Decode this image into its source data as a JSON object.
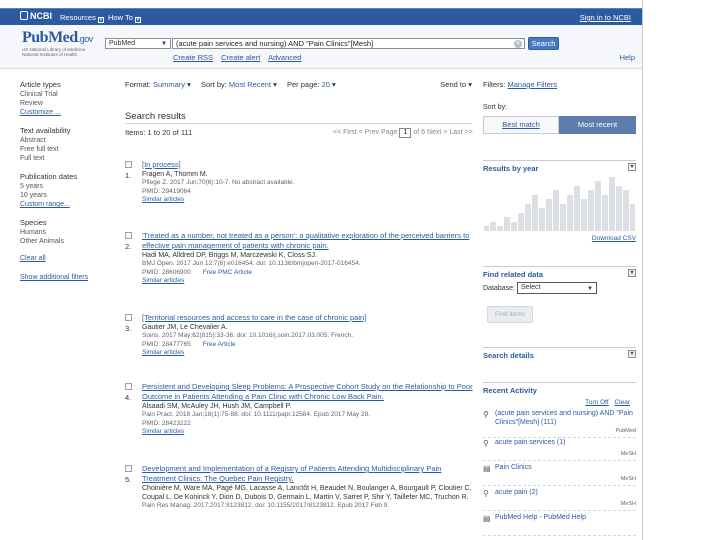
{
  "ncbi_bar": {
    "logo": "NCBI",
    "resources": "Resources",
    "how_to": "How To",
    "sign_in": "Sign in to NCBI"
  },
  "header": {
    "logo_pub": "Pub",
    "logo_med": "Med",
    "logo_gov": ".gov",
    "logo_sub1": "US National Library of Medicine",
    "logo_sub2": "National Institutes of Health",
    "database": "PubMed",
    "query": "(acute pain services and nursing) AND \"Pain Clinics\"[Mesh]",
    "search_label": "Search",
    "create_rss": "Create RSS",
    "create_alert": "Create alert",
    "advanced": "Advanced",
    "help": "Help"
  },
  "sidebar": {
    "groups": [
      {
        "heading": "Article types",
        "items": [
          "Clinical Trial",
          "Review",
          "Customize ..."
        ]
      },
      {
        "heading": "Text availability",
        "items": [
          "Abstract",
          "Free full text",
          "Full text"
        ]
      },
      {
        "heading": "Publication dates",
        "items": [
          "5 years",
          "10 years",
          "Custom range..."
        ]
      },
      {
        "heading": "Species",
        "items": [
          "Humans",
          "Other Animals"
        ]
      }
    ],
    "clear_all": "Clear all",
    "show_additional": "Show additional filters"
  },
  "toolbar": {
    "format_label": "Format:",
    "format_value": "Summary",
    "sort_label": "Sort by:",
    "sort_value": "Most Recent",
    "per_page_label": "Per page:",
    "per_page_value": "20",
    "send_to": "Send to"
  },
  "results": {
    "title": "Search results",
    "count": "Items: 1 to 20 of 111",
    "pager_first": "<< First",
    "pager_prev": "< Prev",
    "pager_page_label": "Page",
    "pager_page": "1",
    "pager_of": "of 6",
    "pager_next": "Next >",
    "pager_last": "Last >>",
    "items": [
      {
        "num": "1.",
        "title": "[In process]",
        "authors": "Fragen A, Thomm M.",
        "cite": "Pflege Z. 2017 Jun;70(6):10-7. No abstract available.",
        "pmid": "PMID: 29419064",
        "free": "",
        "similar": "Similar articles"
      },
      {
        "num": "2.",
        "title": "'Treated as a number, not treated as a person': a qualitative exploration of the perceived barriers to effective pain management of patients with chronic pain.",
        "authors": "Hadi MA, Alldred DP, Briggs M, Marczewski K, Closs SJ.",
        "cite": "BMJ Open. 2017 Jun 12;7(6):e016454. doi: 10.1136/bmjopen-2017-016454.",
        "pmid": "PMID: 28606900",
        "free": "Free PMC Article",
        "similar": "Similar articles"
      },
      {
        "num": "3.",
        "title": "[Territorial resources and access to care in the case of chronic pain]",
        "authors": "Gautier JM, Le Chevalier A.",
        "cite": "Soins. 2017 May;62(815):33-36. doi: 10.1016/j.soin.2017.03.005. French.",
        "pmid": "PMID: 28477765",
        "free": "Free Article",
        "similar": "Similar articles"
      },
      {
        "num": "4.",
        "title": "Persistent and Developing Sleep Problems: A Prospective Cohort Study on the Relationship to Poor Outcome in Patients Attending a Pain Clinic with Chronic Low Back Pain.",
        "authors": "Alsaadi SM, McAuley JH, Hush JM, Campbell P.",
        "cite": "Pain Pract. 2018 Jan;18(1):75-88. doi: 10.1111/papr.12584. Epub 2017 May 28.",
        "pmid": "PMID: 28423222",
        "free": "",
        "similar": "Similar articles"
      },
      {
        "num": "5.",
        "title": "Development and Implementation of a Registry of Patients Attending Multidisciplinary Pain Treatment Clinics: The Quebec Pain Registry.",
        "authors": "Choinière M, Ware MA, Pagé MG, Lacasse A, Lanctôt H, Beaudet N, Boulanger A, Bourgault P, Cloutier C, Coupal L, De Koninck Y, Dion D, Dubois D, Germain L, Martin V, Sarret P, Shir Y, Taillefer MC, Truchon R.",
        "cite": "Pain Res Manag. 2017;2017:8123812. doi: 10.1155/2017/8123812. Epub 2017 Feb 9.",
        "pmid": "",
        "free": "",
        "similar": ""
      }
    ]
  },
  "right": {
    "filters_label": "Filters:",
    "manage_filters": "Manage Filters",
    "sort_by": "Sort by:",
    "best_match": "Best match",
    "most_recent": "Most recent",
    "results_by_year": "Results by year",
    "year_counts": [
      1,
      2,
      1,
      3,
      2,
      4,
      6,
      8,
      5,
      7,
      9,
      6,
      8,
      10,
      7,
      9,
      11,
      8,
      12,
      10,
      9,
      6
    ],
    "download_csv": "Download CSV",
    "find_related": "Find related data",
    "database_label": "Database:",
    "database_value": "Select",
    "find_items": "Find items",
    "search_details": "Search details",
    "recent_activity": "Recent Activity",
    "turn_off": "Turn Off",
    "clear": "Clear",
    "activity": [
      {
        "icon": "search-icon",
        "text": "(acute pain services and nursing) AND \"Pain Clinics\"[Mesh] (111)",
        "tag": "PubMed"
      },
      {
        "icon": "search-icon",
        "text": "acute pain services (1)",
        "tag": "MeSH"
      },
      {
        "icon": "document-icon",
        "text": "Pain Clinics",
        "tag": "MeSH"
      },
      {
        "icon": "search-icon",
        "text": "acute pain (2)",
        "tag": "MeSH"
      },
      {
        "icon": "document-icon",
        "text": "PubMed Help - PubMed Help",
        "tag": ""
      }
    ]
  }
}
